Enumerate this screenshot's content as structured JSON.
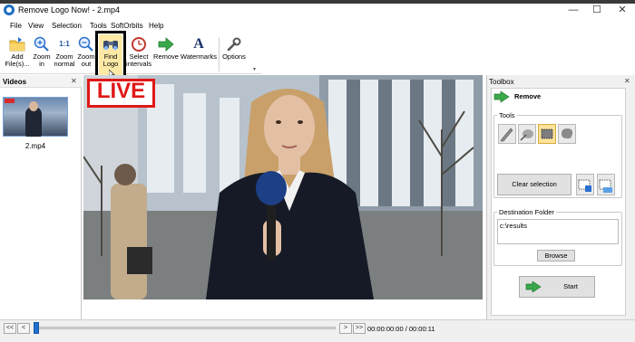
{
  "window": {
    "title": "Remove Logo Now! - 2.mp4",
    "minimize": "—",
    "maximize": "☐",
    "close": "✕"
  },
  "menu": [
    "File",
    "View",
    "Selection",
    "Tools",
    "SoftOrbits",
    "Help"
  ],
  "toolbar": {
    "add_files": "Add\nFile(s)...",
    "zoom_in": "Zoom\nin",
    "zoom_normal": "Zoom\nnormal",
    "zoom_out": "Zoom\nout",
    "find_logo": "Find\nLogo",
    "select_intervals": "Select\nintervals",
    "remove": "Remove",
    "watermarks": "Watermarks",
    "options": "Options",
    "zoom_normal_icon_text": "1:1",
    "watermarks_icon_text": "A"
  },
  "videos_panel": {
    "title": "Videos",
    "close": "✕",
    "items": [
      {
        "name": "2.mp4"
      }
    ]
  },
  "video": {
    "overlay_text": "LIVE"
  },
  "toolbox": {
    "title": "Toolbox",
    "close": "✕",
    "section_title": "Remove",
    "tools_label": "Tools",
    "clear_selection": "Clear selection",
    "destination_label": "Destination Folder",
    "destination_value": "c:\\results",
    "browse": "Browse",
    "start": "Start"
  },
  "player": {
    "time": "00:00:00:00 / 00:00:11",
    "btn_first": "<<",
    "btn_prev": "<",
    "btn_next": ">",
    "btn_last": ">>",
    "position": 0.0
  },
  "colors": {
    "accent_blue": "#1f6fd1",
    "live_red": "#e01818",
    "highlight_yellow": "#fde39a"
  }
}
